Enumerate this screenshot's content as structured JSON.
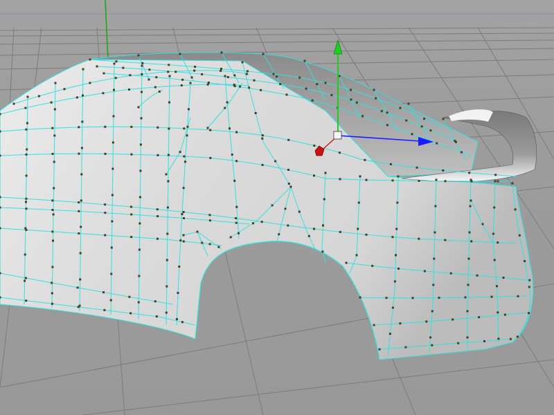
{
  "viewport": {
    "kind": "3d-perspective-viewport",
    "background_color": "#9d9d9d",
    "grid_color": "#7a7a7a",
    "horizon_line_color": "#8a8aa8"
  },
  "scene": {
    "object": "car-body-rear-quarter",
    "display_mode": "shaded-with-wireframe-cage",
    "shading_color": "#e6e6e6",
    "wireframe_color": "#33e0e0",
    "vertex_color": "#4a3a20",
    "wheel_arch": "rear"
  },
  "gizmo": {
    "type": "move-manipulator",
    "y_axis_color": "#22cc22",
    "x_axis_color": "#1a1aff",
    "z_axis_color": "#cc1111"
  },
  "world_axis": {
    "vertical_line_color": "#11aa11"
  }
}
